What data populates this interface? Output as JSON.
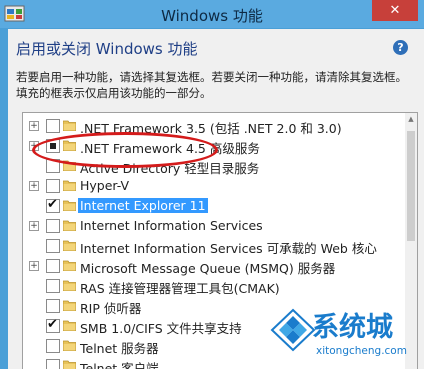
{
  "window": {
    "title": "Windows 功能",
    "close_label": "✕"
  },
  "header": {
    "heading": "启用或关闭 Windows 功能",
    "help_label": "?",
    "description": "若要启用一种功能，请选择其复选框。若要关闭一种功能，请清除其复选框。填充的框表示仅启用该功能的一部分。"
  },
  "features": [
    {
      "label": ".NET Framework 3.5 (包括 .NET 2.0 和 3.0)",
      "state": "unchecked",
      "expandable": true
    },
    {
      "label": ".NET Framework 4.5 高级服务",
      "state": "partial",
      "expandable": true
    },
    {
      "label": "Active Directory 轻型目录服务",
      "state": "unchecked",
      "expandable": false
    },
    {
      "label": "Hyper-V",
      "state": "unchecked",
      "expandable": true
    },
    {
      "label": "Internet Explorer 11",
      "state": "checked",
      "expandable": false,
      "selected": true
    },
    {
      "label": "Internet Information Services",
      "state": "unchecked",
      "expandable": true
    },
    {
      "label": "Internet Information Services 可承载的 Web 核心",
      "state": "unchecked",
      "expandable": false
    },
    {
      "label": "Microsoft Message Queue (MSMQ) 服务器",
      "state": "unchecked",
      "expandable": true
    },
    {
      "label": "RAS 连接管理器管理工具包(CMAK)",
      "state": "unchecked",
      "expandable": false
    },
    {
      "label": "RIP 侦听器",
      "state": "unchecked",
      "expandable": false
    },
    {
      "label": "SMB 1.0/CIFS 文件共享支持",
      "state": "checked",
      "expandable": false
    },
    {
      "label": "Telnet 服务器",
      "state": "unchecked",
      "expandable": false
    },
    {
      "label": "Telnet 客户端",
      "state": "unchecked",
      "expandable": false
    }
  ],
  "watermark": {
    "text": "系统城",
    "url": "xitongcheng.com"
  },
  "colors": {
    "accent": "#4a9fd7",
    "close": "#c7403a",
    "highlight_ellipse": "#d41b1b",
    "selection": "#3399ff"
  }
}
